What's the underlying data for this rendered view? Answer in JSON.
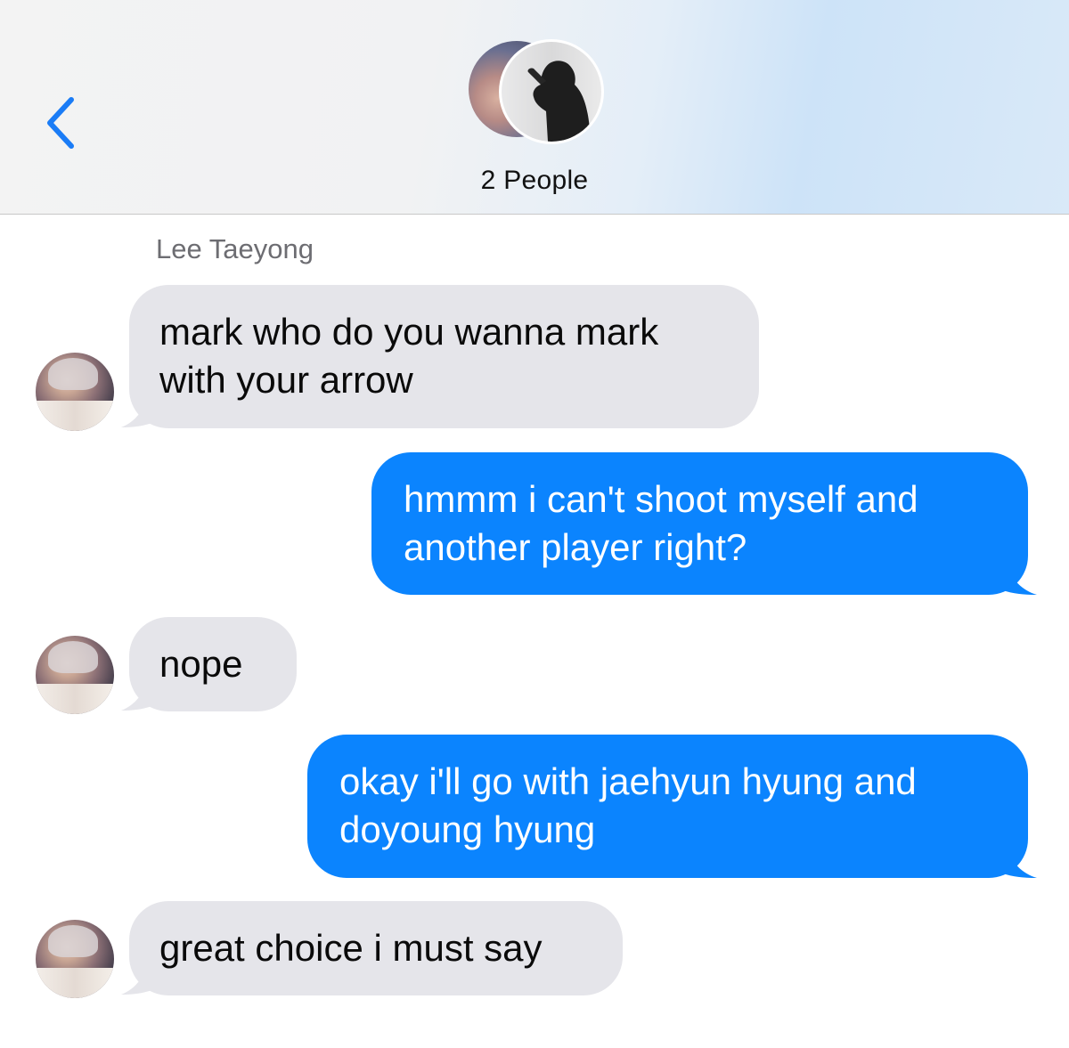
{
  "header": {
    "group_name": "2 People"
  },
  "thread": {
    "sender_name": "Lee Taeyong",
    "messages": [
      {
        "from": "Lee Taeyong",
        "lines": [
          "mark who do you wanna mark",
          "with your arrow"
        ]
      },
      {
        "from": "me",
        "lines": [
          "hmmm i can't shoot myself and",
          "another player right?"
        ]
      },
      {
        "from": "Lee Taeyong",
        "lines": [
          "nope"
        ]
      },
      {
        "from": "me",
        "lines": [
          "okay i'll go with jaehyun hyung and",
          "doyoung hyung"
        ]
      },
      {
        "from": "Lee Taeyong",
        "lines": [
          "great choice i must say"
        ]
      }
    ]
  },
  "colors": {
    "outgoing_bubble": "#0b84fe",
    "incoming_bubble": "#e5e5ea",
    "accent": "#1a7cf6"
  }
}
